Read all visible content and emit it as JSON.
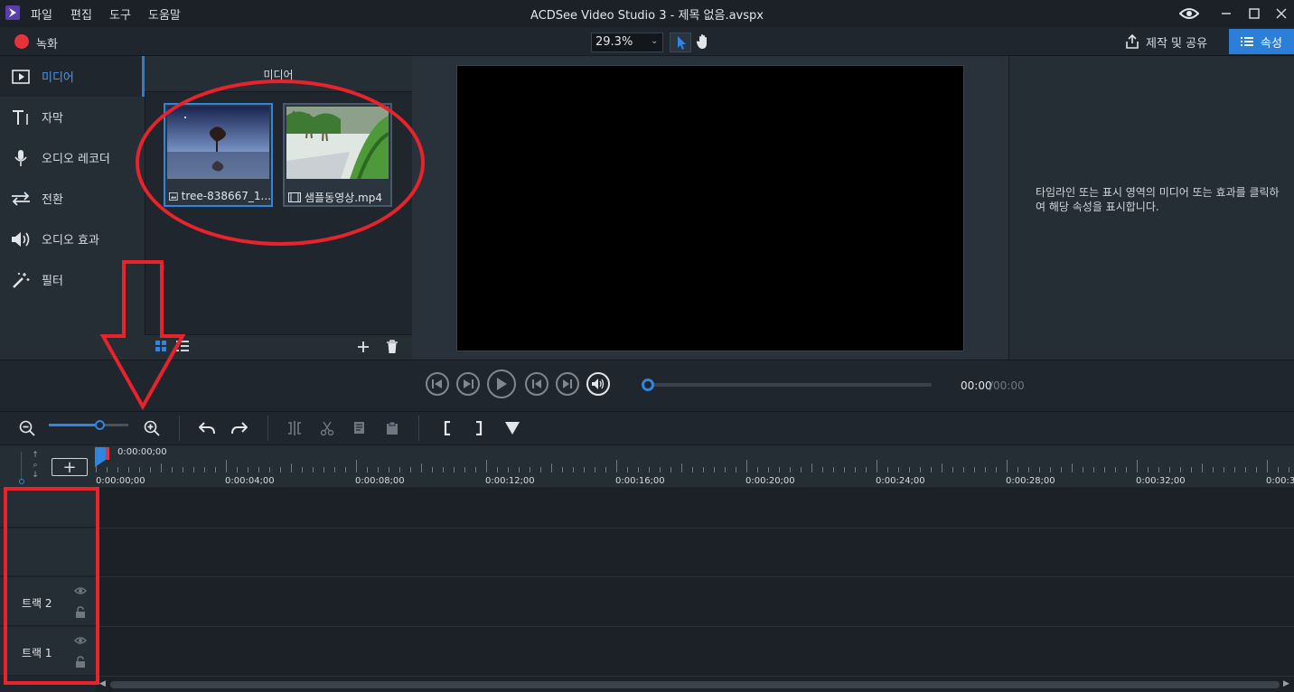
{
  "menu": [
    "파일",
    "편집",
    "도구",
    "도움말"
  ],
  "window": {
    "title": "ACDSee Video Studio 3 - 제목 없음.avspx"
  },
  "toolbar": {
    "record_label": "녹화",
    "zoom_value": "29.3%",
    "share_label": "제작 및 공유",
    "props_label": "속성"
  },
  "sidebar": {
    "items": [
      {
        "label": "미디어",
        "icon": "media-icon",
        "active": true
      },
      {
        "label": "자막",
        "icon": "text-icon"
      },
      {
        "label": "오디오 레코더",
        "icon": "microphone-icon"
      },
      {
        "label": "전환",
        "icon": "transition-icon"
      },
      {
        "label": "오디오 효과",
        "icon": "speaker-icon"
      },
      {
        "label": "필터",
        "icon": "magic-wand-icon"
      }
    ]
  },
  "media": {
    "header": "미디어",
    "items": [
      {
        "name": "tree-838667_1...",
        "type": "image"
      },
      {
        "name": "샘플동영상.mp4",
        "type": "video"
      }
    ]
  },
  "properties": {
    "hint": "타임라인 또는 표시 영역의 미디어 또는 효과를 클릭하여 해당 속성을 표시합니다."
  },
  "playback": {
    "current_time": "00:00",
    "total_time": "/00:00"
  },
  "timeline": {
    "playhead_time": "0:00:00;00",
    "ticks": [
      "0:00:00;00",
      "0:00:04;00",
      "0:00:08;00",
      "0:00:12;00",
      "0:00:16;00",
      "0:00:20;00",
      "0:00:24;00",
      "0:00:28;00",
      "0:00:32;00",
      "0:00:3"
    ],
    "tracks": [
      {
        "label": "트랙 2"
      },
      {
        "label": "트랙 1"
      }
    ]
  },
  "colors": {
    "accent": "#2b7fd8",
    "annotation": "#e8232c",
    "record": "#e8323a"
  }
}
